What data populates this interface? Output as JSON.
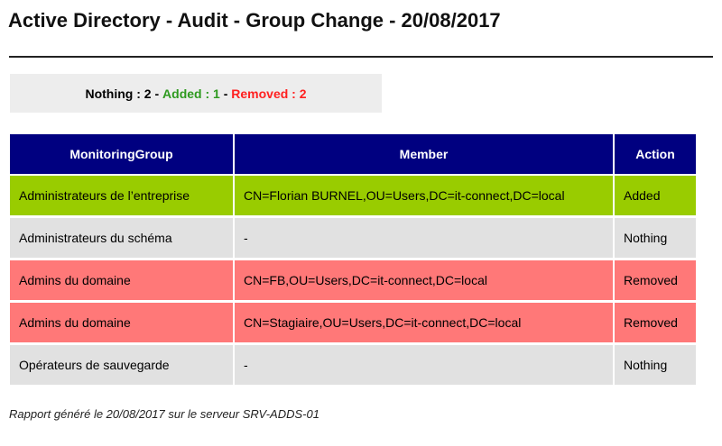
{
  "report": {
    "title": "Active Directory - Audit - Group Change - 20/08/2017"
  },
  "summary": {
    "nothing_text": "Nothing : 2",
    "separator": " - ",
    "added_text": "Added : 1",
    "removed_text": "Removed : 2",
    "colors": {
      "added": "#2e9a1f",
      "removed": "#ff2020",
      "background": "#ededed"
    }
  },
  "table": {
    "headers": [
      "MonitoringGroup",
      "Member",
      "Action"
    ],
    "header_color": "#000080",
    "row_colors": {
      "Added": "#99cc00",
      "Nothing": "#e1e1e1",
      "Removed": "#ff7878"
    },
    "rows": [
      {
        "group": "Administrateurs de l’entreprise",
        "member": "CN=Florian BURNEL,OU=Users,DC=it-connect,DC=local",
        "action": "Added"
      },
      {
        "group": "Administrateurs du schéma",
        "member": "-",
        "action": "Nothing"
      },
      {
        "group": "Admins du domaine",
        "member": "CN=FB,OU=Users,DC=it-connect,DC=local",
        "action": "Removed"
      },
      {
        "group": "Admins du domaine",
        "member": "CN=Stagiaire,OU=Users,DC=it-connect,DC=local",
        "action": "Removed"
      },
      {
        "group": "Opérateurs de sauvegarde",
        "member": "-",
        "action": "Nothing"
      }
    ]
  },
  "footer": {
    "text": "Rapport généré le 20/08/2017 sur le serveur SRV-ADDS-01"
  }
}
